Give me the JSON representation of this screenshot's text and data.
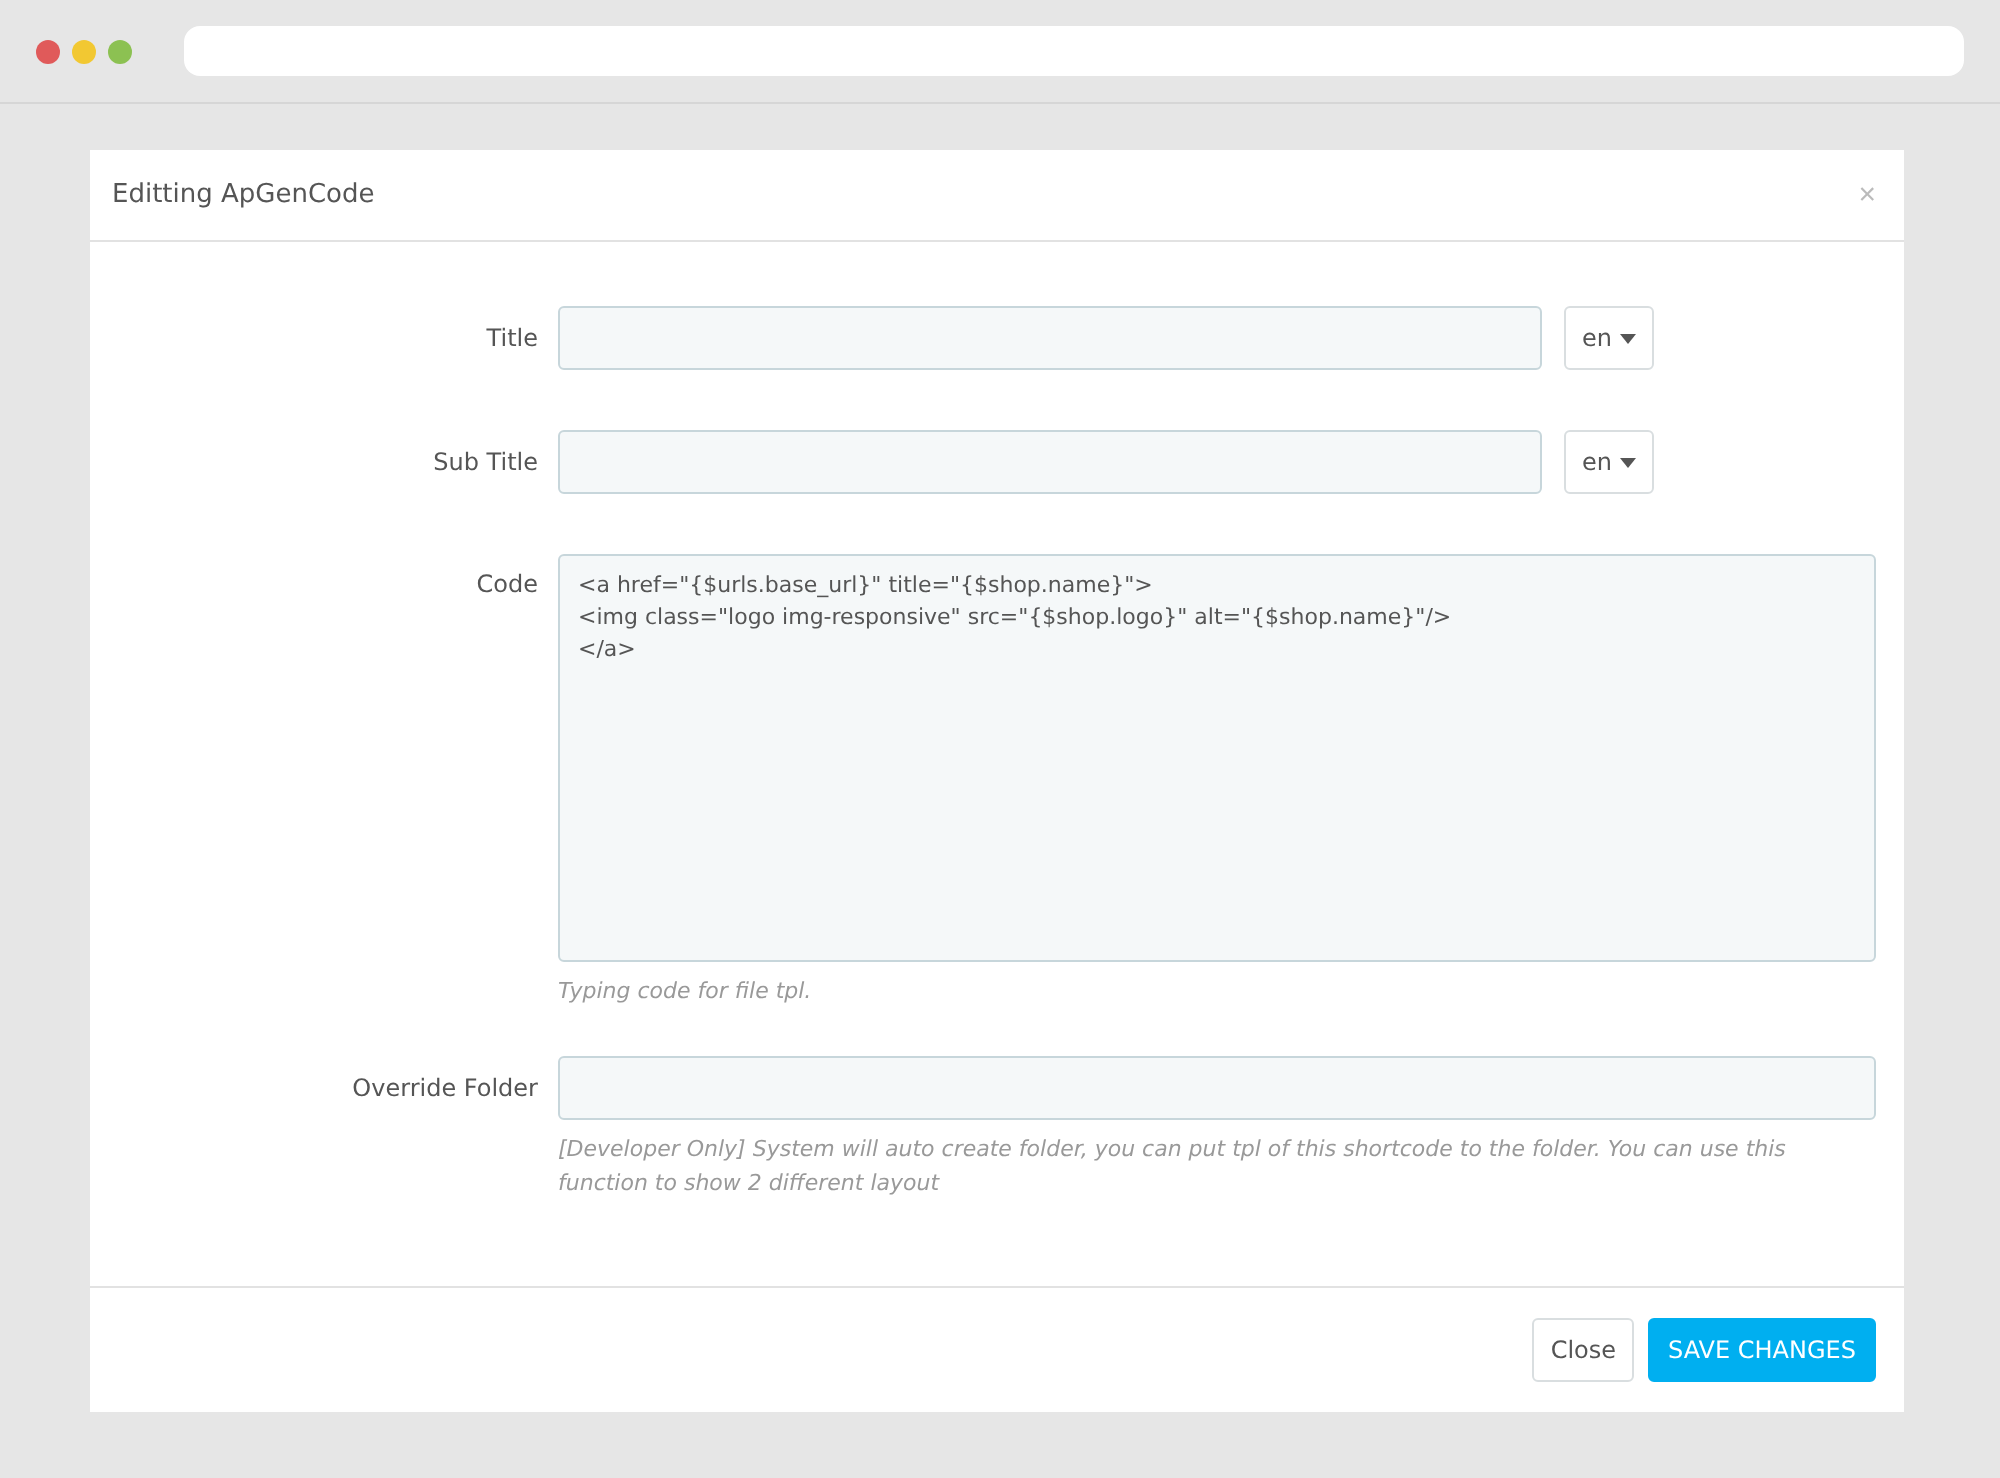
{
  "modal": {
    "title": "Editting ApGenCode",
    "close": "×"
  },
  "fields": [
    {
      "kind": "text",
      "label": "Title",
      "language": "en"
    },
    {
      "kind": "text",
      "label": "Sub Title",
      "language": "en"
    },
    {
      "kind": "code",
      "label": "Code",
      "value": "<a href=\"{$urls.base_url}\" title=\"{$shop.name}\">\n<img class=\"logo img-responsive\" src=\"{$shop.logo}\" alt=\"{$shop.name}\"/>\n</a>",
      "help": "Typing code for file tpl."
    },
    {
      "kind": "plain",
      "label": "Override Folder",
      "help": "[Developer Only] System will auto create folder, you can put tpl of this shortcode to the folder. You can use this function to show 2 different layout"
    }
  ],
  "buttons": [
    {
      "label": "Close",
      "kind": "default"
    },
    {
      "label": "SAVE CHANGES",
      "kind": "primary"
    }
  ]
}
